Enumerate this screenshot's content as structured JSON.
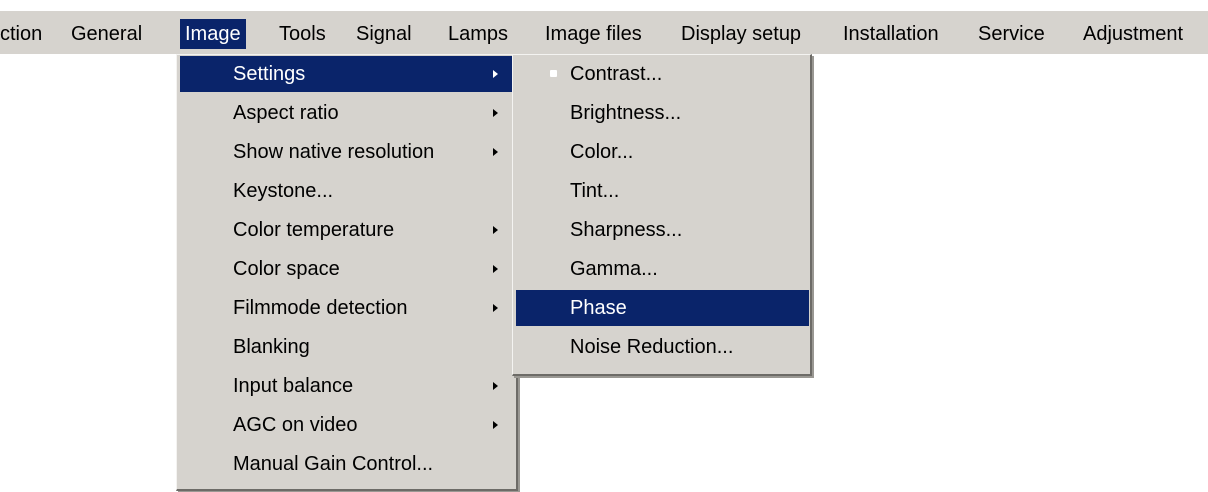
{
  "menubar": {
    "items": [
      "ction",
      "General",
      "Image",
      "Tools",
      "Signal",
      "Lamps",
      "Image files",
      "Display setup",
      "Installation",
      "Service",
      "Adjustment"
    ],
    "active_index": 2
  },
  "image_menu": {
    "items": [
      {
        "label": "Settings",
        "has_submenu": true,
        "selected": true
      },
      {
        "label": "Aspect ratio",
        "has_submenu": true
      },
      {
        "label": "Show native resolution",
        "has_submenu": true
      },
      {
        "label": "Keystone...",
        "has_submenu": false
      },
      {
        "label": "Color temperature",
        "has_submenu": true
      },
      {
        "label": "Color space",
        "has_submenu": true
      },
      {
        "label": "Filmmode detection",
        "has_submenu": true
      },
      {
        "label": "Blanking",
        "has_submenu": false
      },
      {
        "label": "Input balance",
        "has_submenu": true
      },
      {
        "label": "AGC on video",
        "has_submenu": true
      },
      {
        "label": "Manual Gain Control...",
        "has_submenu": false
      }
    ]
  },
  "settings_menu": {
    "items": [
      {
        "label": "Contrast...",
        "current": true
      },
      {
        "label": "Brightness..."
      },
      {
        "label": "Color..."
      },
      {
        "label": "Tint..."
      },
      {
        "label": "Sharpness..."
      },
      {
        "label": "Gamma..."
      },
      {
        "label": "Phase",
        "selected": true
      },
      {
        "label": "Noise Reduction..."
      }
    ]
  },
  "icons": {
    "submenu_arrow": "chevron-right-icon",
    "current_marker": "bullet-icon"
  },
  "colors": {
    "menu_background": "#d6d3ce",
    "highlight": "#0a246a",
    "highlight_text": "#ffffff"
  }
}
